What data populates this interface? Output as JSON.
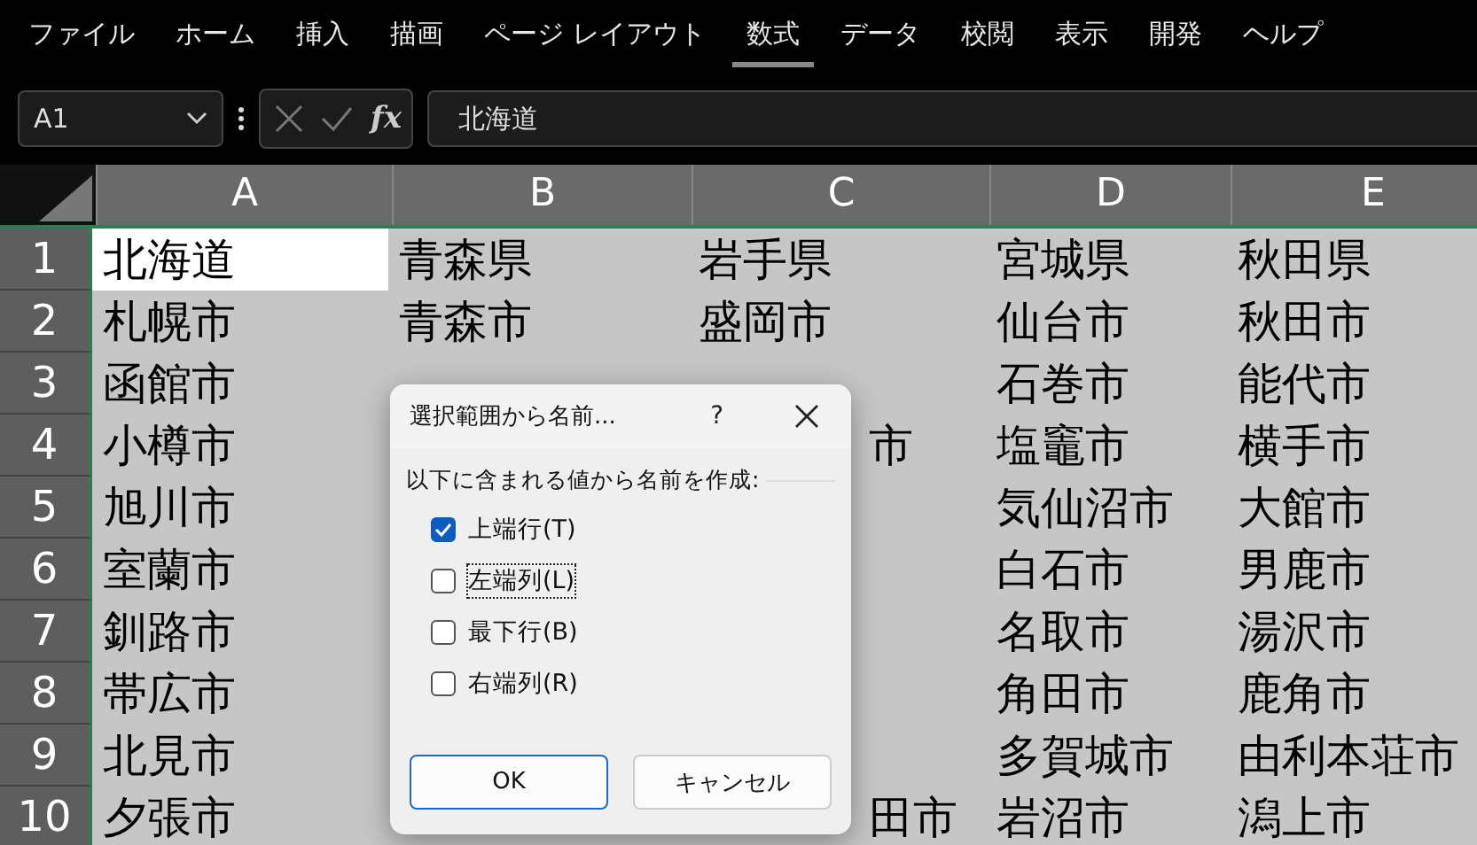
{
  "menu_tabs": [
    {
      "label": "ファイル",
      "selected": false
    },
    {
      "label": "ホーム",
      "selected": false
    },
    {
      "label": "挿入",
      "selected": false
    },
    {
      "label": "描画",
      "selected": false
    },
    {
      "label": "ページ レイアウト",
      "selected": false
    },
    {
      "label": "数式",
      "selected": true
    },
    {
      "label": "データ",
      "selected": false
    },
    {
      "label": "校閲",
      "selected": false
    },
    {
      "label": "表示",
      "selected": false
    },
    {
      "label": "開発",
      "selected": false
    },
    {
      "label": "ヘルプ",
      "selected": false
    }
  ],
  "formula_bar": {
    "name_box": "A1",
    "function_button": "fx",
    "formula": "北海道"
  },
  "columns": [
    "A",
    "B",
    "C",
    "D",
    "E"
  ],
  "rows": [
    {
      "number": "1",
      "cells": [
        {
          "text": "北海道",
          "selected": true,
          "covered": false
        },
        {
          "text": "青森県",
          "selected": false,
          "covered": false
        },
        {
          "text": "岩手県",
          "selected": false,
          "covered": false
        },
        {
          "text": "宮城県",
          "selected": false,
          "covered": false
        },
        {
          "text": "秋田県",
          "selected": false,
          "covered": false
        }
      ]
    },
    {
      "number": "2",
      "cells": [
        {
          "text": "札幌市",
          "selected": false,
          "covered": false
        },
        {
          "text": "青森市",
          "selected": false,
          "covered": false
        },
        {
          "text": "盛岡市",
          "selected": false,
          "covered": false
        },
        {
          "text": "仙台市",
          "selected": false,
          "covered": false
        },
        {
          "text": "秋田市",
          "selected": false,
          "covered": false
        }
      ]
    },
    {
      "number": "3",
      "cells": [
        {
          "text": "函館市",
          "selected": false,
          "covered": false
        },
        null,
        null,
        {
          "text": "石巻市",
          "selected": false,
          "covered": false
        },
        {
          "text": "能代市",
          "selected": false,
          "covered": false
        }
      ]
    },
    {
      "number": "4",
      "cells": [
        {
          "text": "小樽市",
          "selected": false,
          "covered": false
        },
        null,
        {
          "text": "市",
          "selected": false,
          "covered": true
        },
        {
          "text": "塩竈市",
          "selected": false,
          "covered": false
        },
        {
          "text": "横手市",
          "selected": false,
          "covered": false
        }
      ]
    },
    {
      "number": "5",
      "cells": [
        {
          "text": "旭川市",
          "selected": false,
          "covered": false
        },
        null,
        null,
        {
          "text": "気仙沼市",
          "selected": false,
          "covered": false
        },
        {
          "text": "大館市",
          "selected": false,
          "covered": false
        }
      ]
    },
    {
      "number": "6",
      "cells": [
        {
          "text": "室蘭市",
          "selected": false,
          "covered": false
        },
        null,
        null,
        {
          "text": "白石市",
          "selected": false,
          "covered": false
        },
        {
          "text": "男鹿市",
          "selected": false,
          "covered": false
        }
      ]
    },
    {
      "number": "7",
      "cells": [
        {
          "text": "釧路市",
          "selected": false,
          "covered": false
        },
        null,
        null,
        {
          "text": "名取市",
          "selected": false,
          "covered": false
        },
        {
          "text": "湯沢市",
          "selected": false,
          "covered": false
        }
      ]
    },
    {
      "number": "8",
      "cells": [
        {
          "text": "帯広市",
          "selected": false,
          "covered": false
        },
        null,
        null,
        {
          "text": "角田市",
          "selected": false,
          "covered": false
        },
        {
          "text": "鹿角市",
          "selected": false,
          "covered": false
        }
      ]
    },
    {
      "number": "9",
      "cells": [
        {
          "text": "北見市",
          "selected": false,
          "covered": false
        },
        null,
        null,
        {
          "text": "多賀城市",
          "selected": false,
          "covered": false
        },
        {
          "text": "由利本荘市",
          "selected": false,
          "covered": false
        }
      ]
    },
    {
      "number": "10",
      "cells": [
        {
          "text": "夕張市",
          "selected": false,
          "covered": false
        },
        null,
        {
          "text": "田市",
          "selected": false,
          "covered": true
        },
        {
          "text": "岩沼市",
          "selected": false,
          "covered": false
        },
        {
          "text": "潟上市",
          "selected": false,
          "covered": false
        }
      ]
    }
  ],
  "dialog": {
    "title": "選択範囲から名前...",
    "help": "?",
    "group_label": "以下に含まれる値から名前を作成:",
    "checkboxes": [
      {
        "label": "上端行(T)",
        "checked": true,
        "focused": false
      },
      {
        "label": "左端列(L)",
        "checked": false,
        "focused": true
      },
      {
        "label": "最下行(B)",
        "checked": false,
        "focused": false
      },
      {
        "label": "右端列(R)",
        "checked": false,
        "focused": false
      }
    ],
    "buttons": [
      {
        "label": "OK",
        "default": true
      },
      {
        "label": "キャンセル",
        "default": false
      }
    ]
  }
}
